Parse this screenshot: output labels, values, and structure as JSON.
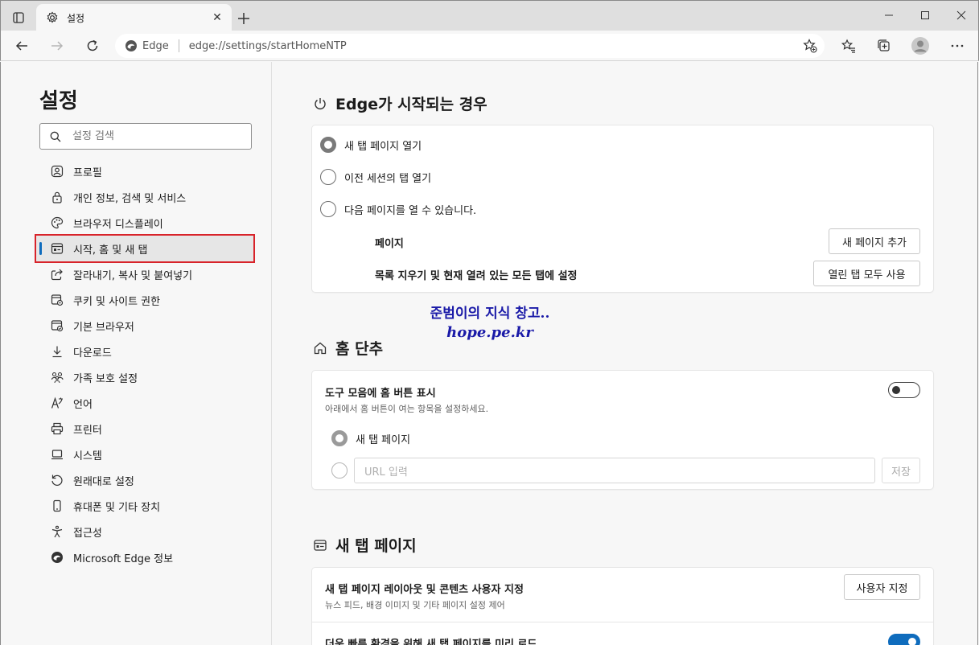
{
  "tab": {
    "title": "설정"
  },
  "toolbar": {
    "edge_label": "Edge",
    "url": "edge://settings/startHomeNTP"
  },
  "sidebar": {
    "title": "설정",
    "search_placeholder": "설정 검색",
    "items": [
      {
        "label": "프로필",
        "icon": "profile-icon"
      },
      {
        "label": "개인 정보, 검색 및 서비스",
        "icon": "lock-icon"
      },
      {
        "label": "브라우저 디스플레이",
        "icon": "palette-icon"
      },
      {
        "label": "시작, 홈 및 새 탭",
        "icon": "window-icon",
        "active": true
      },
      {
        "label": "잘라내기, 복사 및 붙여넣기",
        "icon": "share-icon"
      },
      {
        "label": "쿠키 및 사이트 권한",
        "icon": "cookie-icon"
      },
      {
        "label": "기본 브라우저",
        "icon": "browser-icon"
      },
      {
        "label": "다운로드",
        "icon": "download-icon"
      },
      {
        "label": "가족 보호 설정",
        "icon": "family-icon"
      },
      {
        "label": "언어",
        "icon": "language-icon"
      },
      {
        "label": "프린터",
        "icon": "printer-icon"
      },
      {
        "label": "시스템",
        "icon": "laptop-icon"
      },
      {
        "label": "원래대로 설정",
        "icon": "reset-icon"
      },
      {
        "label": "휴대폰 및 기타 장치",
        "icon": "phone-icon"
      },
      {
        "label": "접근성",
        "icon": "accessibility-icon"
      },
      {
        "label": "Microsoft Edge 정보",
        "icon": "edge-logo-icon"
      }
    ]
  },
  "startup": {
    "title": "Edge가 시작되는 경우",
    "options": [
      "새 탭 페이지 열기",
      "이전 세션의 탭 열기",
      "다음 페이지를 열 수 있습니다."
    ],
    "pages_label": "페이지",
    "add_page_button": "새 페이지 추가",
    "clear_label": "목록 지우기 및 현재 열려 있는 모든 탭에 설정",
    "use_open_tabs_button": "열린 탭 모두 사용"
  },
  "watermark": {
    "line1": "준범이의 지식 창고..",
    "line2": "hope.pe.kr"
  },
  "home": {
    "title": "홈 단추",
    "show_button_label": "도구 모음에 홈 버튼 표시",
    "show_button_sub": "아래에서 홈 버튼이 여는 항목을 설정하세요.",
    "new_tab_option": "새 탭 페이지",
    "url_placeholder": "URL 입력",
    "save_button": "저장"
  },
  "newtab": {
    "title": "새 탭 페이지",
    "customize_label": "새 탭 페이지 레이아웃 및 콘텐츠 사용자 지정",
    "customize_sub": "뉴스 피드, 배경 이미지 및 기타 페이지 설정 제어",
    "customize_button": "사용자 지정",
    "preload_label": "더욱 빠른 환경을 위해 새 탭 페이지를 미리 로드"
  }
}
